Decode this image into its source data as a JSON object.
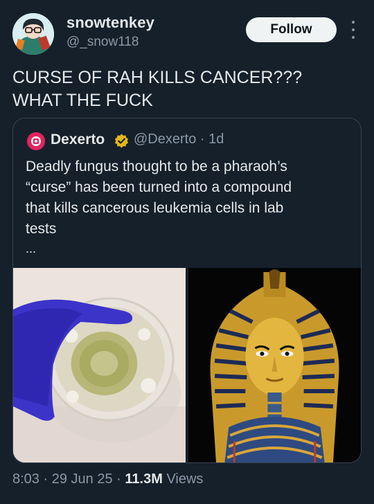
{
  "author": {
    "display_name": "snowtenkey",
    "handle": "@_snow118",
    "follow_label": "Follow"
  },
  "tweet": {
    "text": "CURSE OF RAH KILLS CANCER???\nWHAT THE FUCK"
  },
  "quote": {
    "display_name": "Dexerto",
    "handle": "@Dexerto",
    "separator": "·",
    "age": "1d",
    "text": "Deadly fungus thought to be a pharaoh’s\n“curse” has been turned into a compound\nthat kills cancerous leukemia cells in lab\ntests",
    "ellipsis": "...",
    "media": [
      {
        "icon": "petri-dish-photo"
      },
      {
        "icon": "pharaoh-mask-photo"
      }
    ]
  },
  "meta": {
    "time": "8:03",
    "sep1": "·",
    "date": "29 Jun 25",
    "sep2": "·",
    "views_count": "11.3M",
    "views_label": "Views"
  },
  "colors": {
    "background": "#15202b",
    "text_primary": "#e7e9ea",
    "text_secondary": "#8b98a5",
    "verified_gold": "#e2b719",
    "border": "#38444d"
  }
}
